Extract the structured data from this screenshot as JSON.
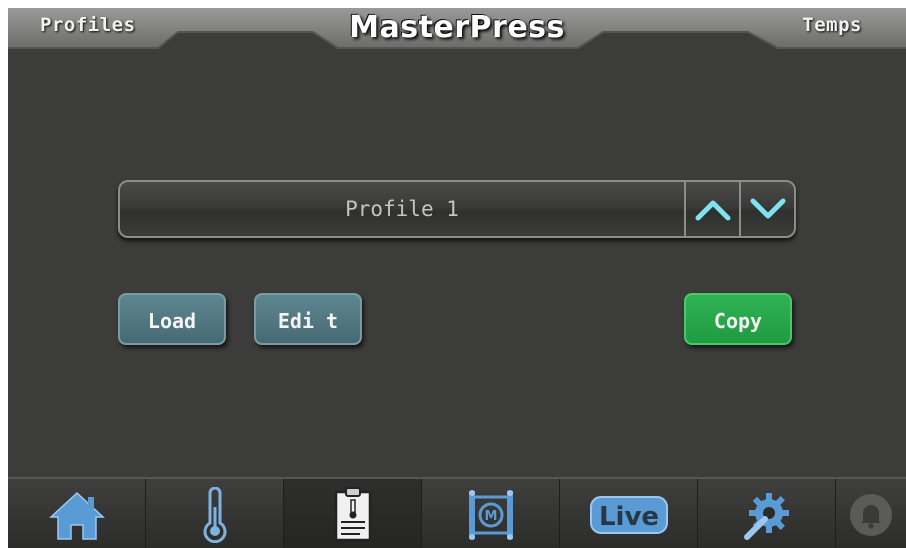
{
  "header": {
    "left_label": "Profiles",
    "title": "MasterPress",
    "right_label": "Temps"
  },
  "profile_selector": {
    "current_profile": "Profile 1"
  },
  "buttons": {
    "load": "Load",
    "edit": "Edi t",
    "copy": "Copy"
  },
  "navbar": {
    "items": [
      {
        "icon": "home-icon",
        "active": false
      },
      {
        "icon": "thermometer-icon",
        "active": false
      },
      {
        "icon": "profile-document-icon",
        "active": true
      },
      {
        "icon": "press-motor-icon",
        "active": false
      },
      {
        "icon": "live-icon",
        "label": "Live",
        "active": false
      },
      {
        "icon": "settings-wrench-gear-icon",
        "active": false
      },
      {
        "icon": "alarm-bell-icon",
        "active": false
      }
    ]
  },
  "colors": {
    "background": "#3c3d3b",
    "accent_arrow": "#7fe3f0",
    "load_edit_button": "#4f7680",
    "copy_button": "#27a84a",
    "nav_icon": "#5b9bd5"
  }
}
